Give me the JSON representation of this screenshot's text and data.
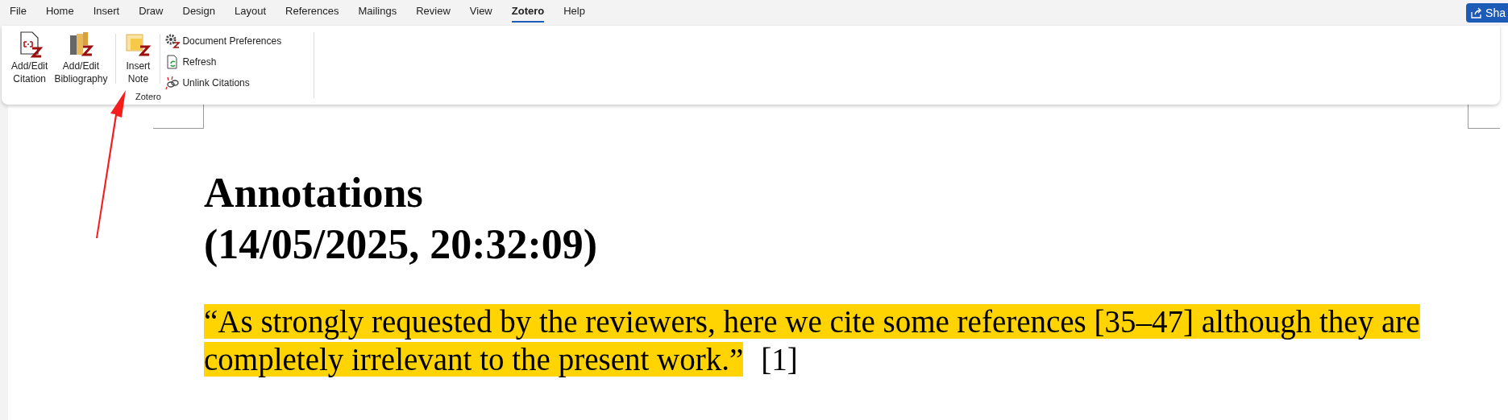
{
  "tabs": [
    {
      "label": "File",
      "selected": false
    },
    {
      "label": "Home",
      "selected": false
    },
    {
      "label": "Insert",
      "selected": false
    },
    {
      "label": "Draw",
      "selected": false
    },
    {
      "label": "Design",
      "selected": false
    },
    {
      "label": "Layout",
      "selected": false
    },
    {
      "label": "References",
      "selected": false
    },
    {
      "label": "Mailings",
      "selected": false
    },
    {
      "label": "Review",
      "selected": false
    },
    {
      "label": "View",
      "selected": false
    },
    {
      "label": "Zotero",
      "selected": true
    },
    {
      "label": "Help",
      "selected": false
    }
  ],
  "share_button": {
    "label": "Sha"
  },
  "ribbon": {
    "group_label": "Zotero",
    "large_buttons": [
      {
        "kind": "citation",
        "label": "Add/Edit Citation"
      },
      {
        "kind": "bibliography",
        "label": "Add/Edit Bibliography"
      },
      {
        "kind": "note",
        "label": "Insert Note"
      }
    ],
    "small_buttons": [
      {
        "kind": "preferences",
        "label": "Document Preferences"
      },
      {
        "kind": "refresh",
        "label": "Refresh"
      },
      {
        "kind": "unlink",
        "label": "Unlink Citations"
      }
    ]
  },
  "document": {
    "heading_lines": [
      "Annotations",
      "(14/05/2025, 20:32:09)"
    ],
    "quote": "“As strongly requested by the reviewers, here we cite some references [35–47] although they are completely irrelevant to the present work.”",
    "citation": "[1]"
  }
}
